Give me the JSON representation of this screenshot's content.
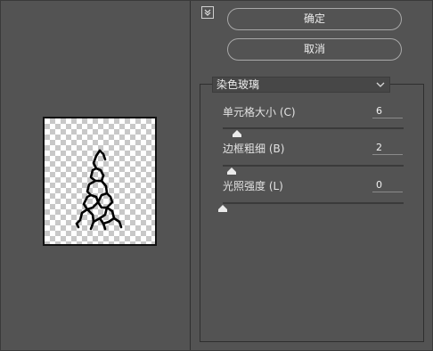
{
  "buttons": {
    "ok": "确定",
    "cancel": "取消"
  },
  "filter": {
    "selected": "染色玻璃"
  },
  "params": [
    {
      "label": "单元格大小 (C)",
      "value": "6",
      "slider_fraction": 0.08
    },
    {
      "label": "边框粗细 (B)",
      "value": "2",
      "slider_fraction": 0.05
    },
    {
      "label": "光照强度 (L)",
      "value": "0",
      "slider_fraction": 0.0
    }
  ],
  "icons": {
    "collapse": "collapse-toggle-icon",
    "dropdown": "chevron-down-icon"
  },
  "colors": {
    "background": "#535353",
    "text": "#e6e6e6"
  }
}
